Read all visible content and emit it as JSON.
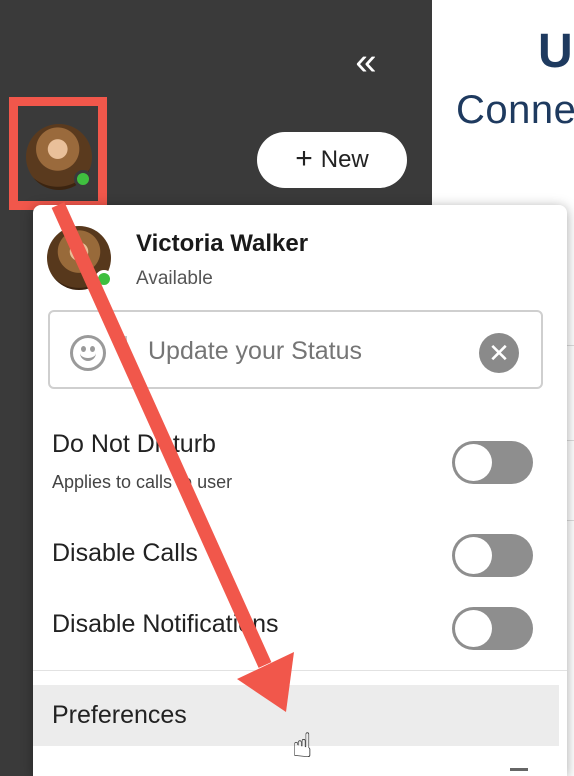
{
  "sidebar": {
    "collapse_glyph": "«",
    "new_button": {
      "plus_glyph": "+",
      "label": "New"
    },
    "avatar": {
      "presence": "available"
    }
  },
  "brand": {
    "mark": "U",
    "text": "Conne"
  },
  "profile_menu": {
    "user_name": "Victoria Walker",
    "user_status": "Available",
    "status_input": {
      "placeholder": "Update your Status",
      "value": ""
    },
    "clear_glyph": "✕",
    "options": [
      {
        "label": "Do Not Disturb",
        "sublabel": "Applies to calls to user",
        "enabled": false
      },
      {
        "label": "Disable Calls",
        "sublabel": "",
        "enabled": false
      },
      {
        "label": "Disable Notifications",
        "sublabel": "",
        "enabled": false
      }
    ],
    "preferences_label": "Preferences"
  },
  "colors": {
    "sidebar_bg": "#3a3a3a",
    "highlight": "#f1574b",
    "presence_green": "#3fbf3f",
    "brand": "#1e3a5f",
    "toggle_off": "#8e8e8e"
  },
  "icons": {
    "collapse": "double-chevron-left-icon",
    "plus": "plus-icon",
    "smiley": "smiley-icon",
    "clear": "clear-circle-icon",
    "cursor": "hand-pointer-icon"
  }
}
